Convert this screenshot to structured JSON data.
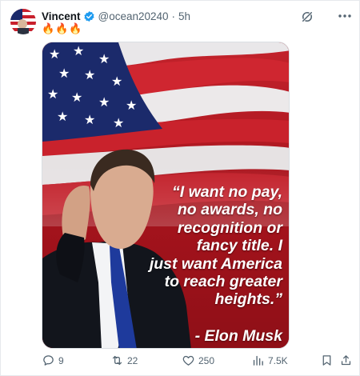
{
  "post": {
    "author_name": "Vincent",
    "handle": "@ocean20240",
    "separator": "·",
    "time": "5h",
    "text_emojis": "🔥🔥🔥"
  },
  "image": {
    "quote_lines": [
      "“I want no pay,",
      "no awards, no",
      "recognition or",
      "fancy title. I",
      "just want America",
      "to reach greater",
      "heights.”"
    ],
    "attribution": "- Elon Musk"
  },
  "actions": {
    "replies": "9",
    "reposts": "22",
    "likes": "250",
    "views": "7.5K"
  },
  "colors": {
    "verified_blue": "#1d9bf0",
    "muted_text": "#536471",
    "flag_red": "#c8202c",
    "flag_blue": "#1b2a6b"
  },
  "icons": [
    "verified-badge-icon",
    "grok-icon",
    "more-icon",
    "reply-icon",
    "repost-icon",
    "like-icon",
    "views-icon",
    "bookmark-icon",
    "share-icon"
  ]
}
